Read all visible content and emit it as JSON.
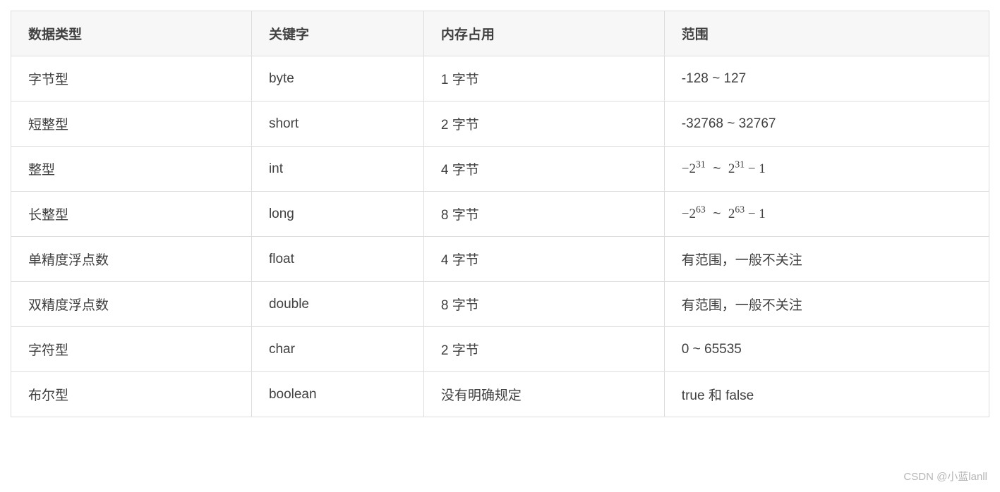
{
  "table": {
    "headers": [
      "数据类型",
      "关键字",
      "内存占用",
      "范围"
    ],
    "rows": [
      {
        "type": "字节型",
        "keyword": "byte",
        "memory": "1 字节",
        "range_text": "-128 ~ 127",
        "range_kind": "plain"
      },
      {
        "type": "短整型",
        "keyword": "short",
        "memory": "2 字节",
        "range_text": "-32768 ~ 32767",
        "range_kind": "plain"
      },
      {
        "type": "整型",
        "keyword": "int",
        "memory": "4 字节",
        "range_kind": "pow",
        "exp": "31"
      },
      {
        "type": "长整型",
        "keyword": "long",
        "memory": "8 字节",
        "range_kind": "pow",
        "exp": "63"
      },
      {
        "type": "单精度浮点数",
        "keyword": "float",
        "memory": "4 字节",
        "range_text": "有范围，一般不关注",
        "range_kind": "plain"
      },
      {
        "type": "双精度浮点数",
        "keyword": "double",
        "memory": "8 字节",
        "range_text": "有范围，一般不关注",
        "range_kind": "plain"
      },
      {
        "type": "字符型",
        "keyword": "char",
        "memory": "2 字节",
        "range_text": "0 ~ 65535",
        "range_kind": "plain"
      },
      {
        "type": "布尔型",
        "keyword": "boolean",
        "memory": "没有明确规定",
        "range_text": "true 和 false",
        "range_kind": "plain"
      }
    ]
  },
  "watermark": "CSDN @小蓝lanll",
  "chart_data": {
    "type": "table",
    "title": "",
    "columns": [
      "数据类型",
      "关键字",
      "内存占用",
      "范围"
    ],
    "rows": [
      [
        "字节型",
        "byte",
        "1 字节",
        "-128 ~ 127"
      ],
      [
        "短整型",
        "short",
        "2 字节",
        "-32768 ~ 32767"
      ],
      [
        "整型",
        "int",
        "4 字节",
        "-2^31 ~ 2^31 - 1"
      ],
      [
        "长整型",
        "long",
        "8 字节",
        "-2^63 ~ 2^63 - 1"
      ],
      [
        "单精度浮点数",
        "float",
        "4 字节",
        "有范围，一般不关注"
      ],
      [
        "双精度浮点数",
        "double",
        "8 字节",
        "有范围，一般不关注"
      ],
      [
        "字符型",
        "char",
        "2 字节",
        "0 ~ 65535"
      ],
      [
        "布尔型",
        "boolean",
        "没有明确规定",
        "true 和 false"
      ]
    ]
  }
}
